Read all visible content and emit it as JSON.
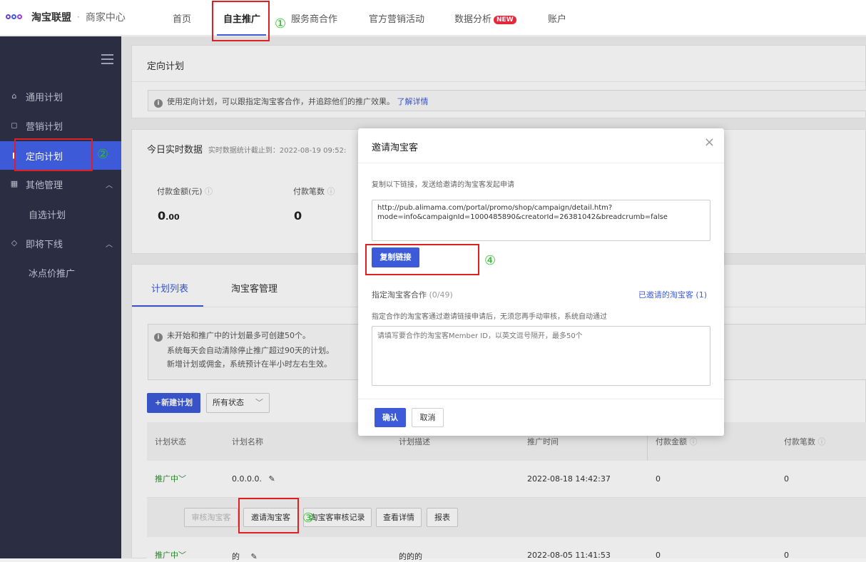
{
  "topbar": {
    "brand": "淘宝联盟",
    "separator": "·",
    "subtitle": "商家中心",
    "nav": [
      "首页",
      "自主推广",
      "服务商合作",
      "官方营销活动",
      "数据分析",
      "账户"
    ],
    "new_badge": "NEW"
  },
  "sidebar": {
    "items": [
      {
        "label": "通用计划",
        "icon": "store-icon"
      },
      {
        "label": "营销计划",
        "icon": "bag-icon"
      },
      {
        "label": "定向计划",
        "icon": "book-icon"
      },
      {
        "label": "其他管理",
        "icon": "grid-icon"
      },
      {
        "label": "自选计划"
      },
      {
        "label": "即将下线",
        "icon": "tag-icon"
      },
      {
        "label": "冰点价推广"
      }
    ]
  },
  "page": {
    "title": "定向计划",
    "tip": "使用定向计划，可以跟指定淘宝客合作，并追踪他们的推广效果。",
    "tip_link": "了解详情"
  },
  "realtime": {
    "title": "今日实时数据",
    "subtitle": "实时数据统计截止到：2022-08-19 09:52:",
    "metrics": [
      {
        "label": "付款金额(元)",
        "value": "0",
        "decimal": ".00"
      },
      {
        "label": "付款笔数",
        "value": "0"
      }
    ]
  },
  "plans": {
    "tabs": [
      "计划列表",
      "淘宝客管理"
    ],
    "notes": [
      "未开始和推广中的计划最多可创建50个。",
      "系统每天会自动清除停止推广超过90天的计划。",
      "新增计划或佣金，系统预计在半小时左右生效。"
    ],
    "new_button": "+新建计划",
    "status_filter": "所有状态",
    "columns": [
      "计划状态",
      "计划名称",
      "计划描述",
      "推广时间",
      "付款金额",
      "付款笔数"
    ],
    "rows": [
      {
        "status": "推广中",
        "name": "0.0.0.0.",
        "desc": "",
        "time": "2022-08-18 14:42:37",
        "amount": "0",
        "count": "0"
      },
      {
        "status": "推广中",
        "name": "的",
        "desc": "的的的",
        "time": "2022-08-05 11:41:53",
        "amount": "0",
        "count": "0"
      }
    ],
    "row_actions": [
      "审核淘宝客",
      "邀请淘宝客",
      "淘宝客审核记录",
      "查看详情",
      "报表"
    ]
  },
  "modal": {
    "title": "邀请淘宝客",
    "instruction": "复制以下链接，发送给邀请的淘宝客发起申请",
    "link_line1": "http://pub.alimama.com/portal/promo/shop/campaign/detail.htm?",
    "link_line2": "mode=info&campaignId=1000485890&creatorId=26381042&breadcrumb=false",
    "copy_button": "复制链接",
    "assign_label": "指定淘宝客合作",
    "assign_count": "(0/49)",
    "invited_link": "已邀请的淘宝客",
    "invited_count": "(1)",
    "assign_desc": "指定合作的淘宝客通过邀请链接申请后，无须您再手动审核，系统自动通过",
    "member_placeholder": "请填写要合作的淘宝客Member ID，以英文逗号隔开，最多50个",
    "confirm": "确认",
    "cancel": "取消"
  },
  "annotations": [
    "①",
    "②",
    "③",
    "④"
  ]
}
